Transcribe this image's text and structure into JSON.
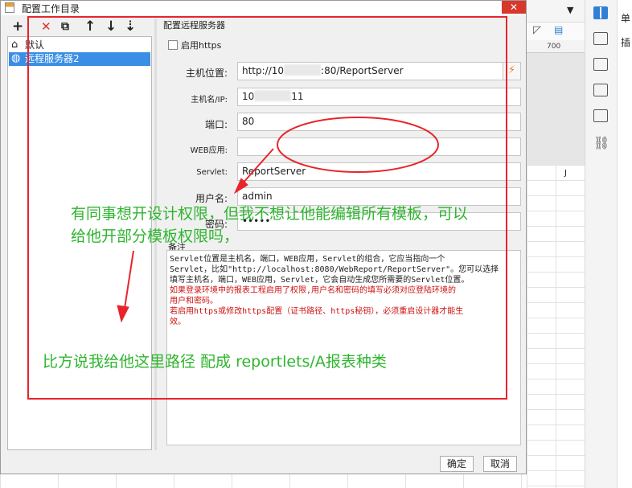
{
  "window": {
    "title": "配置工作目录",
    "close_glyph": "✕"
  },
  "tree_toolbar": {
    "add": "+",
    "delete": "✕",
    "copy": "⧉",
    "up": "↑",
    "down": "↓",
    "sort": "⇣"
  },
  "tree": {
    "items": [
      {
        "label": "默认",
        "icon": "home-icon"
      },
      {
        "label": "远程服务器2",
        "icon": "globe-icon"
      }
    ]
  },
  "form": {
    "section_title": "配置远程服务器",
    "https_label": "启用https",
    "host_label": "主机位置:",
    "host_value_a": "http://10",
    "host_value_b": ":80/ReportServer",
    "hostname_label": "主机名/IP:",
    "hostname_value_a": "10",
    "hostname_value_b": "11",
    "port_label": "端口:",
    "port_value": "80",
    "webapp_label": "WEB应用:",
    "webapp_value": "",
    "servlet_label": "Servlet:",
    "servlet_value": "ReportServer",
    "user_label": "用户名:",
    "user_value": "admin",
    "password_label": "密码:",
    "password_value": "•••••",
    "notes_label": "备注",
    "notes": [
      "Servlet位置是主机名，端口，WEB应用，Servlet的组合，它应当指向一个",
      "Servlet，比如\"http://localhost:8080/WebReport/ReportServer\"。您可以选择",
      "填写主机名，端口，WEB应用，Servlet，它会自动生成您所需要的Servlet位置。"
    ],
    "notes_red": [
      "如果登录环境中的报表工程启用了权限,用户名和密码的填写必须对应登陆环境的",
      "用户和密码。",
      "若启用https或修改https配置（证书路径、https秘钥），必须重启设计器才能生",
      "效。"
    ]
  },
  "buttons": {
    "ok": "确定",
    "cancel": "取消"
  },
  "annotations": {
    "line1": "有同事想开设计权限，但我不想让他能编辑所有模板，可以",
    "line2": "给他开部分模板权限吗，",
    "line3": "比方说我给他这里路径 配成 reportlets/A报表种类",
    "color": "#2fb52f",
    "rect_color": "#e8242a"
  },
  "background": {
    "ruler_label": "700",
    "column_label": "J",
    "far_right_1": "单",
    "far_right_2": "插"
  }
}
